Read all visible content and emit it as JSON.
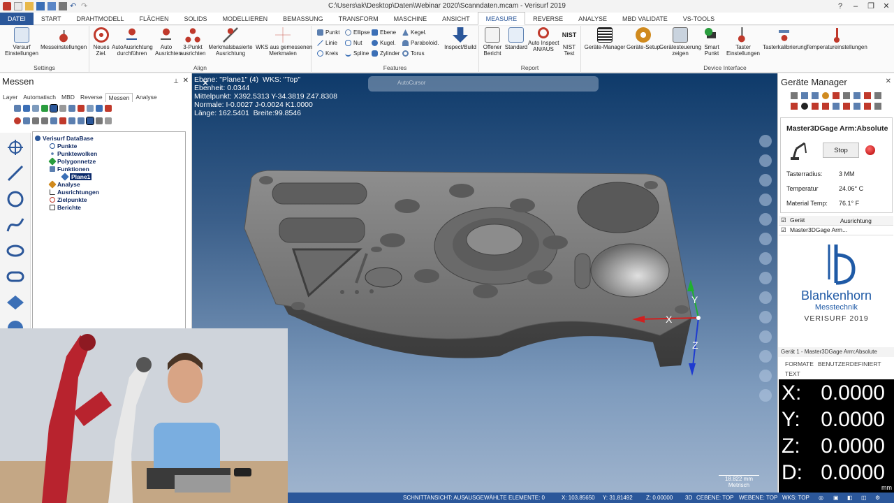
{
  "window": {
    "title": "C:\\Users\\ak\\Desktop\\Daten\\Webinar 2020\\Scanndaten.mcam - Verisurf 2019"
  },
  "tabs": [
    {
      "label": "DATEI"
    },
    {
      "label": "START"
    },
    {
      "label": "DRAHTMODELL"
    },
    {
      "label": "FLÄCHEN"
    },
    {
      "label": "SOLIDS"
    },
    {
      "label": "MODELLIEREN"
    },
    {
      "label": "BEMASSUNG"
    },
    {
      "label": "TRANSFORM"
    },
    {
      "label": "MASCHINE"
    },
    {
      "label": "ANSICHT"
    },
    {
      "label": "MEASURE"
    },
    {
      "label": "REVERSE"
    },
    {
      "label": "ANALYSE"
    },
    {
      "label": "MBD VALIDATE"
    },
    {
      "label": "VS-TOOLS"
    }
  ],
  "ribbon": {
    "settings": {
      "label": "Settings",
      "b1": "Versurf\nEinstellungen",
      "b2": "Messeinstellungen"
    },
    "align": {
      "label": "Align",
      "b1": "Neues\nZiel.",
      "b2": "AutoAusrichtung\ndurchführen",
      "b3": "Auto\nAusrichten",
      "b4": "3-Punkt\nausrichten",
      "b5": "Merkmalsbasierte\nAusrichtung",
      "b6": "WKS aus gemessenen\nMerkmalen"
    },
    "features": {
      "label": "Features",
      "f": [
        "Punkt",
        "Ellipse",
        "Ebene",
        "Kegel.",
        "Linie",
        "Nut",
        "Kugel.",
        "Paraboloid.",
        "Kreis",
        "Spline",
        "Zylinder",
        "Torus"
      ],
      "b": "Inspect/Build"
    },
    "report": {
      "label": "Report",
      "b1": "Offener\nBericht",
      "b2": "Standard",
      "b3": "Auto Inspect\nAN/AUS",
      "b4": "NIST\nTest"
    },
    "device": {
      "label": "Device Interface",
      "b1": "Geräte-Manager",
      "b2": "Geräte-Setup",
      "b3": "Gerätesteuerung\nzeigen",
      "b4": "Smart\nPunkt",
      "b5": "Taster\nEinstellungen",
      "b6": "Tasterkalibrierung",
      "b7": "Temperatureinstellungen"
    }
  },
  "left": {
    "title": "Messen",
    "tabs": [
      "Layer",
      "Automatisch",
      "MBD",
      "Reverse",
      "Messen",
      "Analyse"
    ],
    "tree": [
      "Verisurf DataBase",
      "Punkte",
      "Punktewolken",
      "Polygonnetze",
      "Funktionen",
      "Plane1",
      "Analyse",
      "Ausrichtungen",
      "Zielpunkte",
      "Berichte"
    ]
  },
  "viewport": {
    "info": "Ebene: \"Plane1\" (4)  WKS: \"Top\"\nEbenheit: 0.0344\nMittelpunkt: X392.5313 Y-34.3819 Z47.8308\nNormale: I-0.0027 J-0.0024 K1.0000\nLänge: 162.5401  Breite:99.8546",
    "autocursor": "AutoCursor",
    "scale": "18.822 mm",
    "scale_unit": "Metrisch",
    "axis": {
      "x": "X",
      "y": "Y",
      "z": "Z"
    }
  },
  "right": {
    "title": "Geräte Manager",
    "device": "Master3DGage Arm:Absolute",
    "stop": "Stop",
    "tasterradius_l": "Tasterradius:",
    "tasterradius_v": "3 MM",
    "temp_l": "Temperatur",
    "temp_v": "24.06° C",
    "mat_l": "Material Temp:",
    "mat_v": "76.1° F",
    "col1": "Gerät",
    "col2": "Ausrichtung",
    "row": "Master3DGage Arm...",
    "logo_name": "Blankenhorn",
    "logo_sub": "Messtechnik",
    "logo_ver": "VERISURF 2019",
    "dro_head": "Gerät 1 - Master3DGage Arm:Absolute",
    "dro_tab1": "FORMATE",
    "dro_tab2": "BENUTZERDEFINIERT",
    "dro_tab3": "TEXT",
    "dro": [
      {
        "k": "X:",
        "v": "0.0000"
      },
      {
        "k": "Y:",
        "v": "0.0000"
      },
      {
        "k": "Z:",
        "v": "0.0000"
      },
      {
        "k": "D:",
        "v": "0.0000"
      }
    ],
    "unit": "mm"
  },
  "status": {
    "schnitt": "SCHNITTANSICHT: AUS",
    "sel": "AUSGEWÄHLTE ELEMENTE: 0",
    "x": "X:  103.85650",
    "y": "Y:  31.81492",
    "z": "Z:  0.00000",
    "d": "3D",
    "cebene": "CEBENE: TOP",
    "webene": "WEBENE: TOP",
    "wks": "WKS: TOP"
  },
  "colors": {
    "accent": "#2b579a",
    "viewport_top": "#0e3a6a"
  }
}
